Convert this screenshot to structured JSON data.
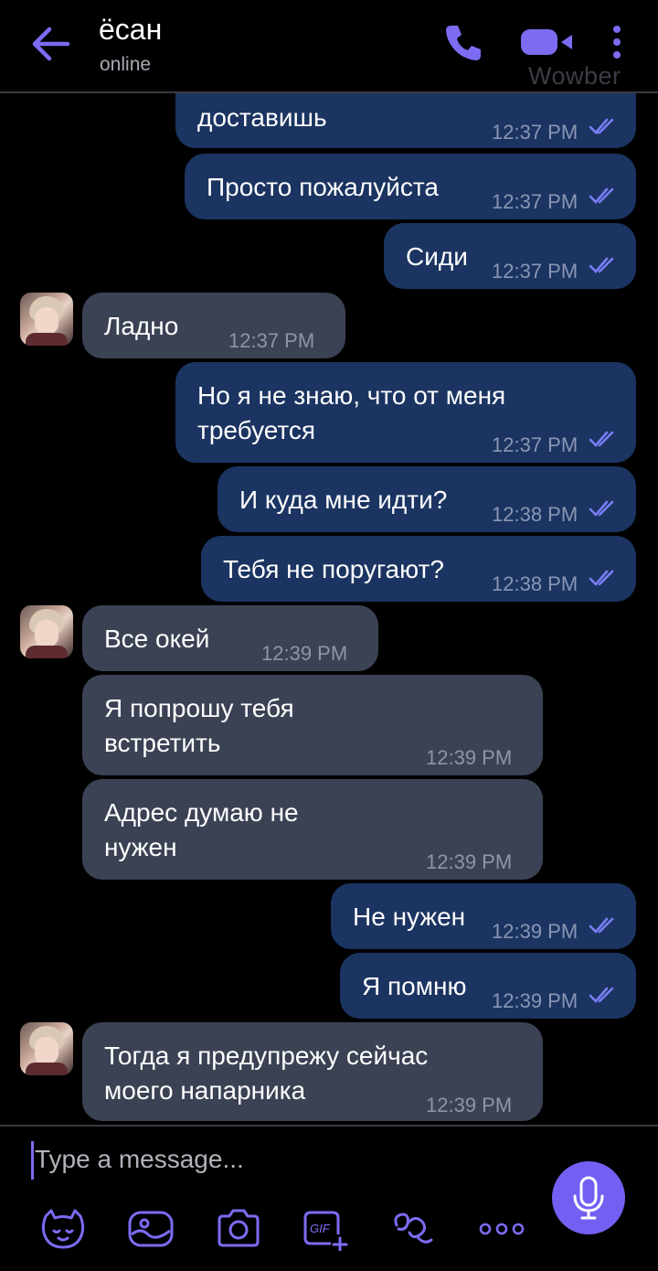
{
  "header": {
    "contact_name": "ёсан",
    "status": "online",
    "watermark": "Wowber"
  },
  "messages": [
    {
      "dir": "out",
      "text": "доставишь",
      "time": "12:37 PM"
    },
    {
      "dir": "out",
      "text": "Просто пожалуйста",
      "time": "12:37 PM"
    },
    {
      "dir": "out",
      "text": "Сиди",
      "time": "12:37 PM"
    },
    {
      "dir": "in",
      "text": "Ладно",
      "time": "12:37 PM"
    },
    {
      "dir": "out",
      "text": "Но я не знаю, что от меня",
      "text2": "требуется",
      "time": "12:37 PM"
    },
    {
      "dir": "out",
      "text": "И куда мне идти?",
      "time": "12:38 PM"
    },
    {
      "dir": "out",
      "text": "Тебя не поругают?",
      "time": "12:38 PM"
    },
    {
      "dir": "in",
      "text": "Все окей",
      "time": "12:39 PM"
    },
    {
      "dir": "in",
      "text": "Я попрошу тебя",
      "text2": "встретить",
      "time": "12:39 PM"
    },
    {
      "dir": "in",
      "text": "Адрес думаю не",
      "text2": "нужен",
      "time": "12:39 PM"
    },
    {
      "dir": "out",
      "text": "Не нужен",
      "time": "12:39 PM"
    },
    {
      "dir": "out",
      "text": "Я помню",
      "time": "12:39 PM"
    },
    {
      "dir": "in",
      "text": "Тогда я предупрежу сейчас",
      "text2": "моего напарника",
      "time": "12:39 PM"
    }
  ],
  "composer": {
    "placeholder": "Type a message..."
  },
  "colors": {
    "accent": "#7360f2",
    "outgoing_bubble": "#1b3461",
    "incoming_bubble": "#3b4254",
    "read_ticks": "#7b7ef5"
  },
  "icons": [
    "back-arrow-icon",
    "phone-icon",
    "video-icon",
    "more-vertical-icon",
    "sticker-icon",
    "gallery-icon",
    "camera-icon",
    "gif-icon",
    "doodle-icon",
    "more-horizontal-icon",
    "microphone-icon"
  ]
}
